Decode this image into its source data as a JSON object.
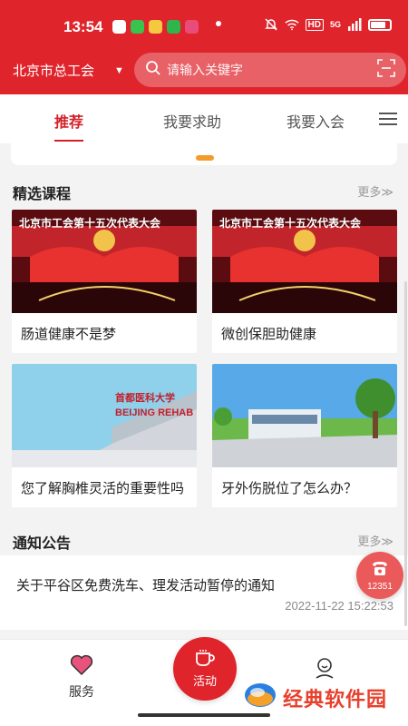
{
  "status_bar": {
    "time": "13:54",
    "hd_label": "HD",
    "signal_label": "5G"
  },
  "header": {
    "region": "北京市总工会",
    "search_placeholder": "请输入关键字"
  },
  "tabs": [
    {
      "label": "推荐",
      "active": true
    },
    {
      "label": "我要求助",
      "active": false
    },
    {
      "label": "我要入会",
      "active": false
    }
  ],
  "courses": {
    "title": "精选课程",
    "more": "更多≫",
    "items": [
      {
        "title": "肠道健康不是梦",
        "thumb_text": "北京市工会第十五次代表大会"
      },
      {
        "title": "微创保胆助健康",
        "thumb_text": "北京市工会第十五次代表大会"
      },
      {
        "title": "您了解胸椎灵活的重要性吗",
        "thumb_text": "首都医科大学 BEIJING REHAB"
      },
      {
        "title": "牙外伤脱位了怎么办？"
      }
    ]
  },
  "notice": {
    "title": "通知公告",
    "more": "更多≫",
    "item_text": "关于平谷区免费洗车、理发活动暂停的通知",
    "item_date": "2022-11-22 15:22:53"
  },
  "hotline": {
    "number": "12351"
  },
  "bottom_nav": {
    "service": "服务",
    "activity": "活动"
  },
  "watermark": {
    "text": "经典软件园"
  },
  "colors": {
    "brand_red": "#e0242c",
    "accent_orange": "#f39c2b"
  }
}
